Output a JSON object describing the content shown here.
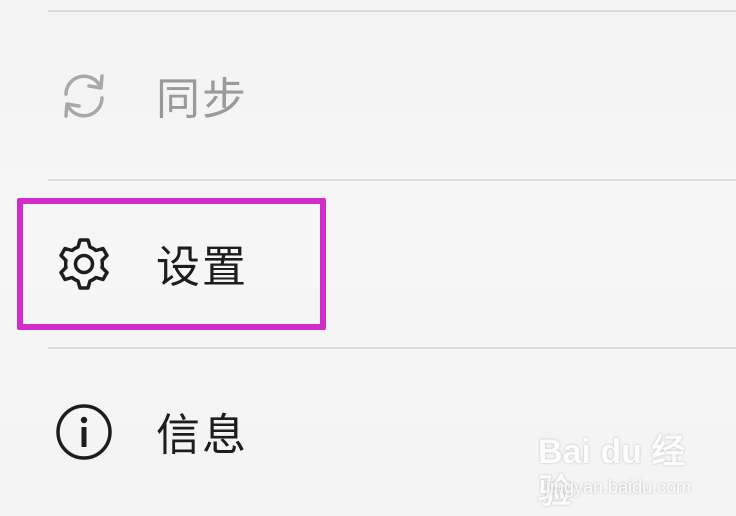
{
  "menu": {
    "items": [
      {
        "label": "同步",
        "icon": "sync-icon",
        "state": "disabled"
      },
      {
        "label": "设置",
        "icon": "gear-icon",
        "state": "enabled",
        "highlighted": true
      },
      {
        "label": "信息",
        "icon": "info-icon",
        "state": "enabled"
      }
    ]
  },
  "highlight": {
    "color": "#d32cc9"
  },
  "watermark": {
    "brand": "Bai du 经验",
    "sub": "jingyan.baidu.com"
  }
}
